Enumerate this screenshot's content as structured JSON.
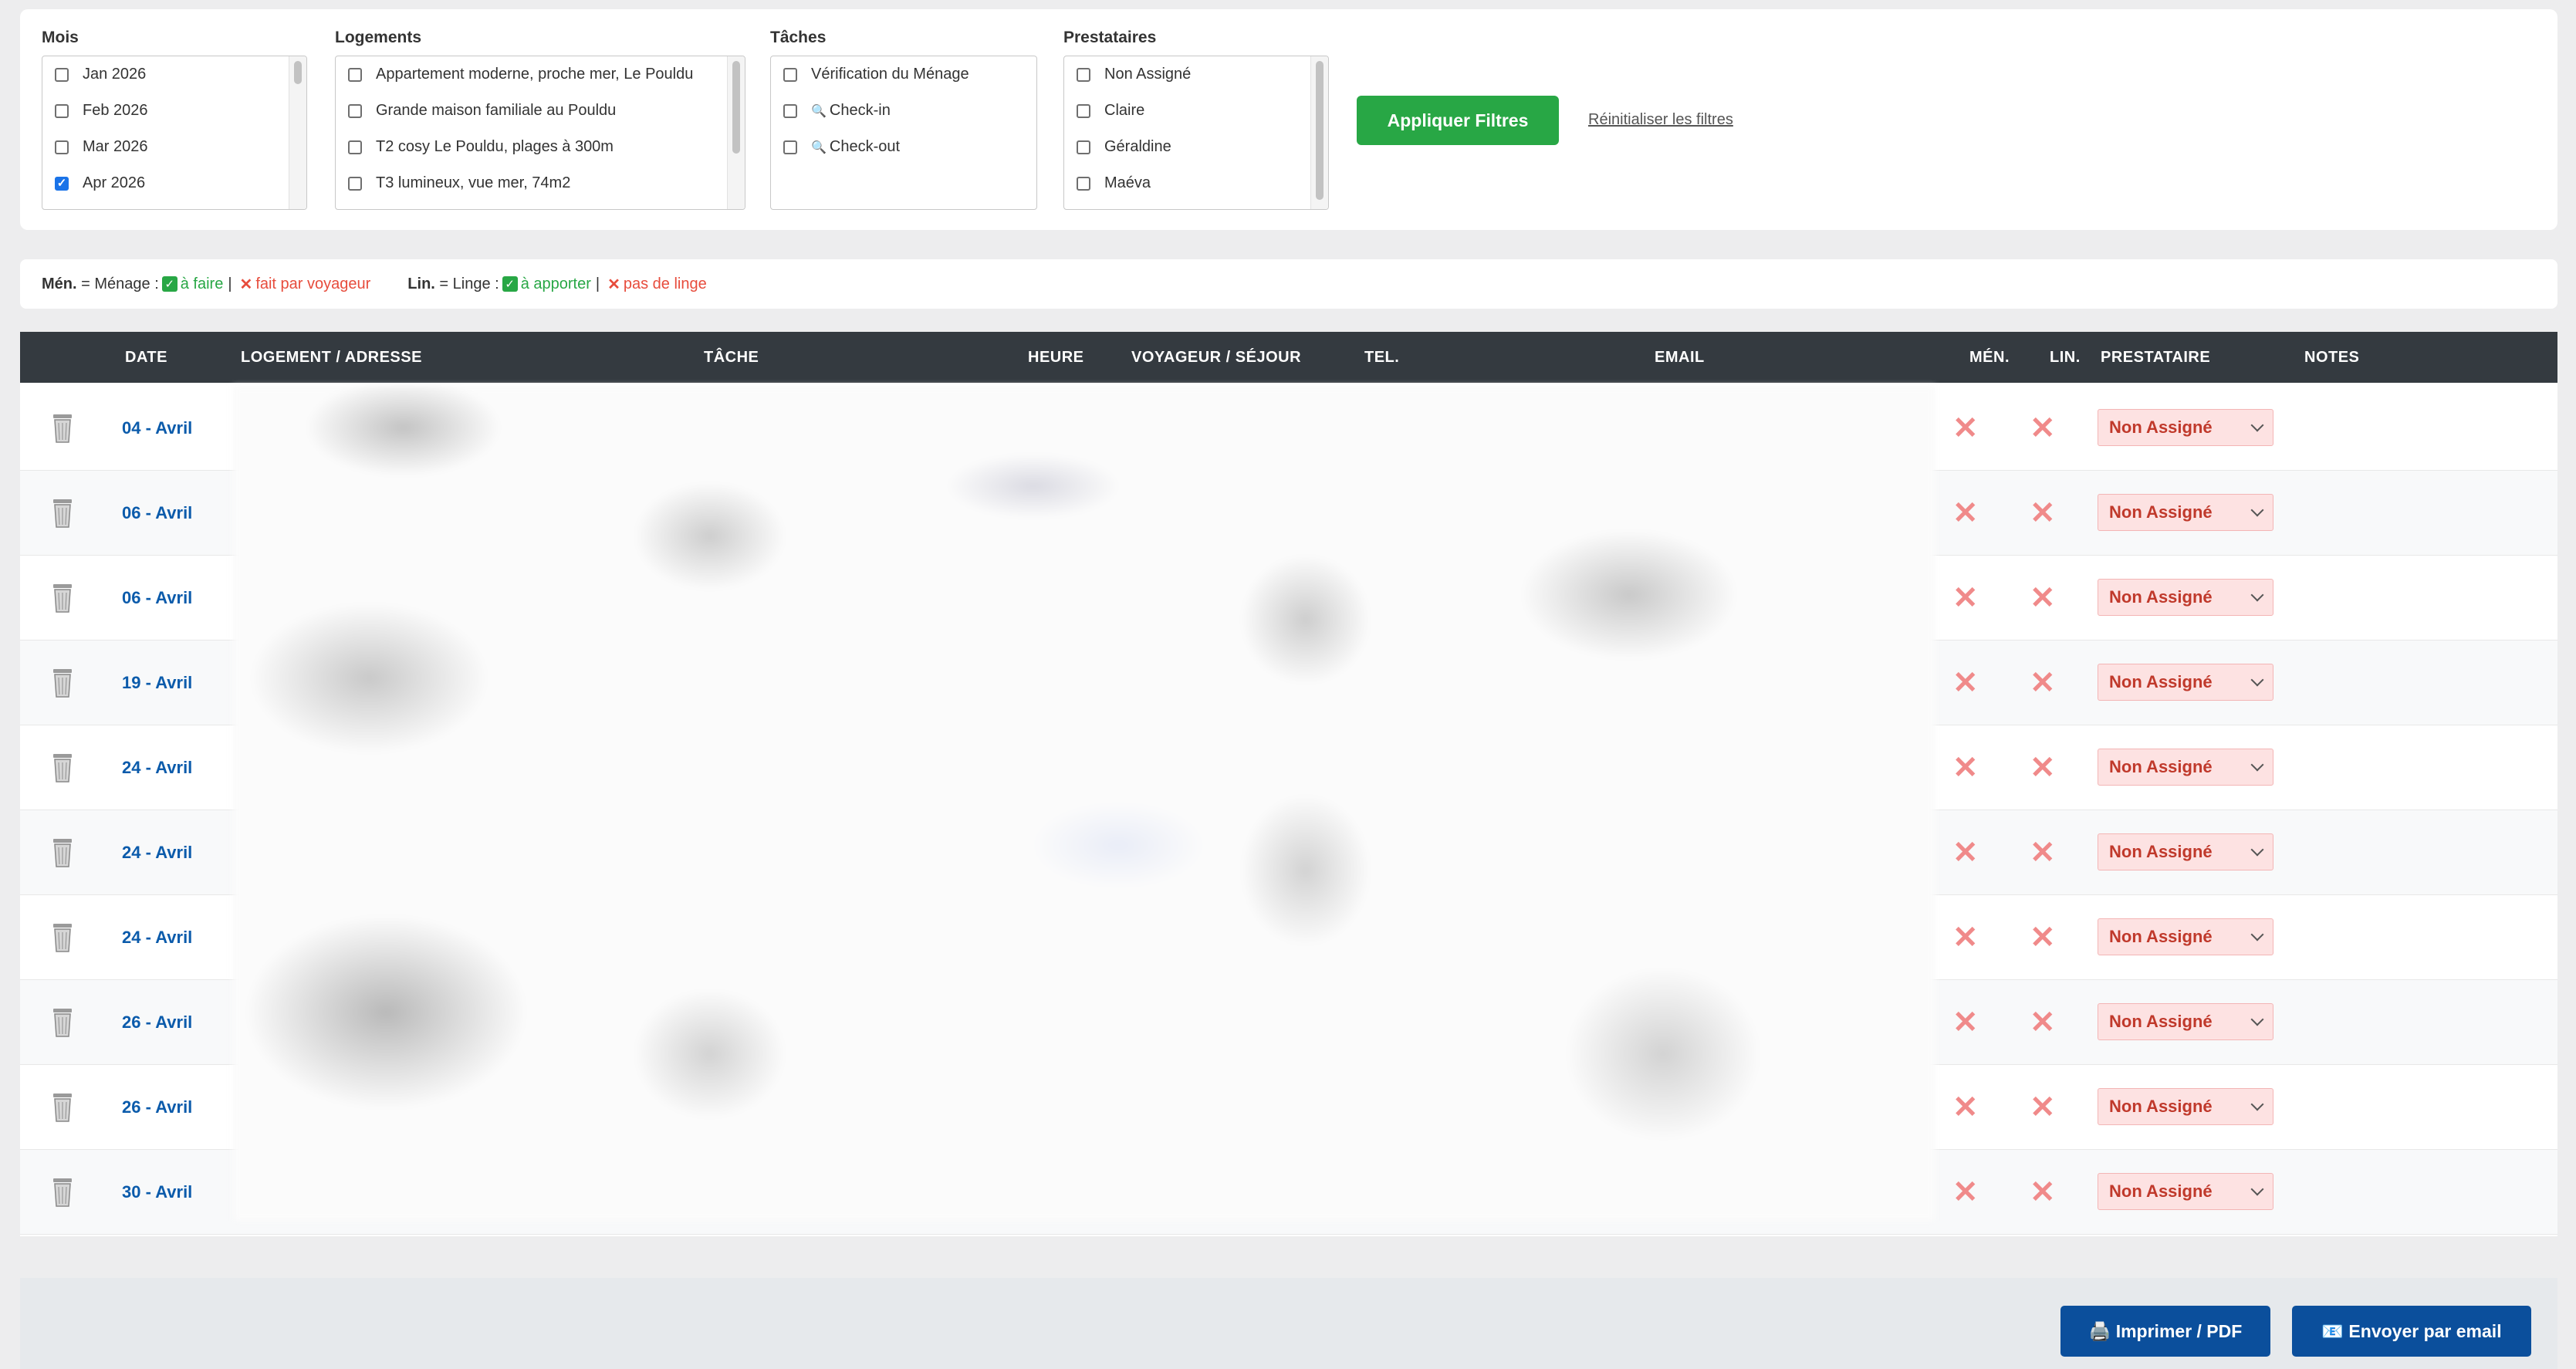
{
  "filters": {
    "mois": {
      "label": "Mois",
      "options": [
        {
          "label": "Jan 2026",
          "checked": false
        },
        {
          "label": "Feb 2026",
          "checked": false
        },
        {
          "label": "Mar 2026",
          "checked": false
        },
        {
          "label": "Apr 2026",
          "checked": true
        }
      ]
    },
    "logements": {
      "label": "Logements",
      "options": [
        {
          "label": "Appartement moderne, proche mer, Le Pouldu",
          "checked": false
        },
        {
          "label": "Grande maison familiale au Pouldu",
          "checked": false
        },
        {
          "label": "T2 cosy Le Pouldu, plages à 300m",
          "checked": false
        },
        {
          "label": "T3 lumineux, vue mer, 74m2",
          "checked": false
        }
      ]
    },
    "taches": {
      "label": "Tâches",
      "options": [
        {
          "label": "Vérification du Ménage",
          "checked": false
        },
        {
          "label": "Check-in",
          "checked": false,
          "icon": "magnifier-icon"
        },
        {
          "label": "Check-out",
          "checked": false,
          "icon": "magnifier-icon"
        }
      ]
    },
    "prestataires": {
      "label": "Prestataires",
      "options": [
        {
          "label": "Non Assigné",
          "checked": false
        },
        {
          "label": "Claire",
          "checked": false
        },
        {
          "label": "Géraldine",
          "checked": false
        },
        {
          "label": "Maéva",
          "checked": false
        }
      ]
    },
    "apply_label": "Appliquer Filtres",
    "reset_label": "Réinitialiser les filtres"
  },
  "legend": {
    "men_abbr": "Mén.",
    "men_text": "= Ménage :",
    "men_todo": "à faire",
    "men_done": "fait par voyageur",
    "lin_abbr": "Lin.",
    "lin_text": "= Linge :",
    "lin_bring": "à apporter",
    "lin_none": "pas de linge",
    "separator": "|"
  },
  "table": {
    "headers": {
      "date": "DATE",
      "logement": "LOGEMENT / ADRESSE",
      "tache": "TÂCHE",
      "heure": "HEURE",
      "voyageur": "VOYAGEUR / SÉJOUR",
      "tel": "TEL.",
      "email": "EMAIL",
      "men": "MÉN.",
      "lin": "LIN.",
      "prestataire": "PRESTATAIRE",
      "notes": "NOTES"
    },
    "rows": [
      {
        "date": "04 - Avril",
        "men": "✕",
        "lin": "✕",
        "prestataire": "Non Assigné"
      },
      {
        "date": "06 - Avril",
        "men": "✕",
        "lin": "✕",
        "prestataire": "Non Assigné"
      },
      {
        "date": "06 - Avril",
        "men": "✕",
        "lin": "✕",
        "prestataire": "Non Assigné"
      },
      {
        "date": "19 - Avril",
        "men": "✕",
        "lin": "✕",
        "prestataire": "Non Assigné"
      },
      {
        "date": "24 - Avril",
        "men": "✕",
        "lin": "✕",
        "prestataire": "Non Assigné"
      },
      {
        "date": "24 - Avril",
        "men": "✕",
        "lin": "✕",
        "prestataire": "Non Assigné"
      },
      {
        "date": "24 - Avril",
        "men": "✕",
        "lin": "✕",
        "prestataire": "Non Assigné"
      },
      {
        "date": "26 - Avril",
        "men": "✕",
        "lin": "✕",
        "prestataire": "Non Assigné"
      },
      {
        "date": "26 - Avril",
        "men": "✕",
        "lin": "✕",
        "prestataire": "Non Assigné"
      },
      {
        "date": "30 - Avril",
        "men": "✕",
        "lin": "✕",
        "prestataire": "Non Assigné"
      }
    ]
  },
  "footer": {
    "print_label": "🖨️ Imprimer / PDF",
    "email_label": "📧 Envoyer par email"
  },
  "colors": {
    "apply_button": "#28a745",
    "header_bg": "#343a40",
    "date_text": "#0b5bab",
    "assign_text": "#c0392b",
    "footer_button": "#0b4f9c"
  }
}
